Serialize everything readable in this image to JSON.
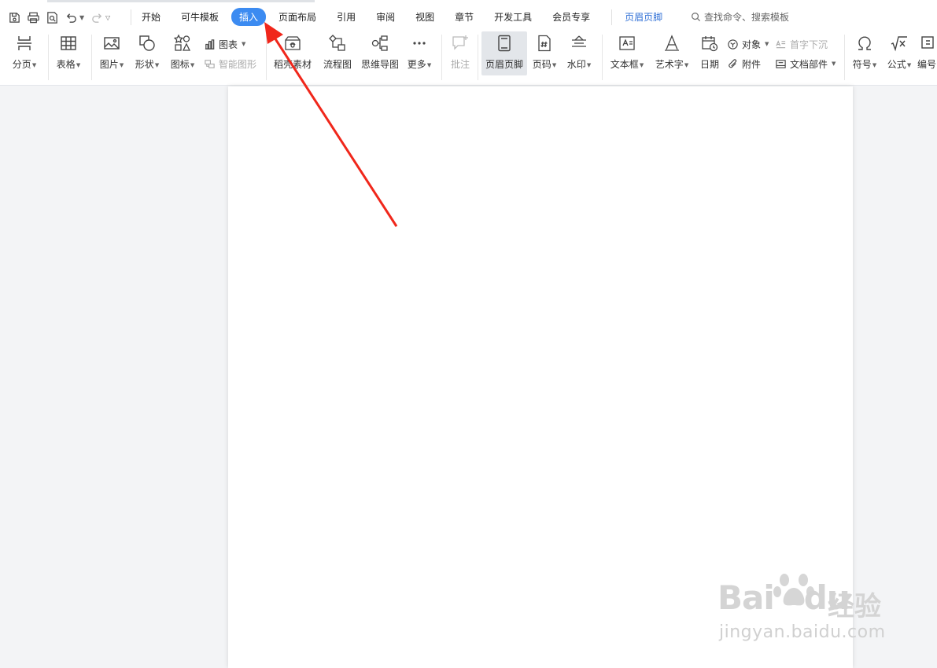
{
  "tabs": [
    {
      "label": "开始"
    },
    {
      "label": "可牛模板"
    },
    {
      "label": "插入",
      "active": true
    },
    {
      "label": "页面布局"
    },
    {
      "label": "引用"
    },
    {
      "label": "审阅"
    },
    {
      "label": "视图"
    },
    {
      "label": "章节"
    },
    {
      "label": "开发工具"
    },
    {
      "label": "会员专享"
    }
  ],
  "context_tab": "页眉页脚",
  "search": {
    "placeholder": "查找命令、搜索模板",
    "icon": "search-icon"
  },
  "ribbon": {
    "page_break": "分页",
    "table": "表格",
    "picture": "图片",
    "shape": "形状",
    "icons": "图标",
    "chart": "图表",
    "smart_art": "智能图形",
    "docer_material": "稻壳素材",
    "flowchart": "流程图",
    "mindmap": "思维导图",
    "more": "更多",
    "comment": "批注",
    "header_footer": "页眉页脚",
    "page_number": "页码",
    "watermark": "水印",
    "textbox": "文本框",
    "wordart": "艺术字",
    "date": "日期",
    "object": "对象",
    "attachment": "附件",
    "drop_cap": "首字下沉",
    "doc_parts": "文档部件",
    "symbol": "符号",
    "formula": "公式",
    "numbering": "编号"
  },
  "watermark": {
    "logo": "Bai du 经验",
    "logo_left": "Bai",
    "logo_right": "du",
    "jingyan": "经验",
    "url": "jingyan.baidu.com"
  },
  "colors": {
    "accent": "#3c8bf1",
    "context_tab": "#2f6fd6",
    "annotation_arrow": "#f0271b",
    "page_bg": "#f3f4f6"
  }
}
